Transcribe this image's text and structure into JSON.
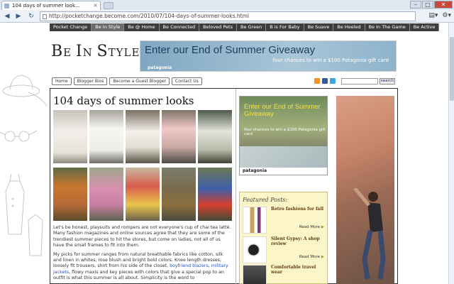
{
  "browser": {
    "tab_title": "104 days of summer look...",
    "tab_close": "×",
    "url": "http://pocketchange.become.com/2010/07/104-days-of-summer-looks.html",
    "back": "◀",
    "forward": "▶",
    "reload": "↻",
    "page_menu": "▤▾",
    "tools_menu": "⚙▾",
    "window_buttons": [
      "–",
      "□",
      "✕"
    ]
  },
  "site_nav": [
    "Pocket Change",
    "Be In Style",
    "Be @ Home",
    "Be Connected",
    "Beloved Pets",
    "Be Green",
    "B is For Baby",
    "Be Suave",
    "Be Heeled",
    "Be In The Game",
    "Be Active"
  ],
  "site_nav_active": "Be In Style",
  "logo": {
    "part1": "B",
    "part2": "E ",
    "part3": "I",
    "part4": "N ",
    "part5": "S",
    "part6": "TYLE"
  },
  "banner_top": {
    "headline": "Enter our End of Summer Giveaway",
    "sub": "four chances to win a $100 Patagonia gift card",
    "brand": "patagonia"
  },
  "sub_nav": [
    "Home",
    "Blogger Bios",
    "Become a Guest Blogger",
    "Contact Us"
  ],
  "search": {
    "button": "search"
  },
  "post": {
    "title": "104 days of summer looks",
    "p1": "Let's be honest, playsuits and rompers are not everyone's cup of chai tea latté. Many fashion magazines and online sources agree that they are some of the trendiest summer pieces to hit the stores, but come on ladies, not all of us have the small frames to fit into them.",
    "p2_a": "My picks for summer ranges from natural breathable fabrics like cotton, silk and linen in whites, rose blush and bright bold colors. Knee length dresses, loosely fit trousers, shirt from his side of the closet, ",
    "p2_link1": "boyfriend blazers",
    "p2_b": ", ",
    "p2_link2": "military jackets",
    "p2_c": ", flowy maxis and key pieces with colors that give a special pop to an outfit is what this summer is all about. Simplicity is the word to"
  },
  "ad_mid": {
    "headline": "Enter our End of Summer Giveaway",
    "sub": "four chances to win a $100 Patagonia gift card",
    "brand": "patagonia"
  },
  "featured": {
    "heading": "Featured Posts:",
    "items": [
      {
        "title": "Retro fashions for fall",
        "more": "Read More"
      },
      {
        "title": "Silent Gypsy: A shop review",
        "more": "Read More"
      },
      {
        "title": "Comfortable travel wear",
        "more": "Read More"
      }
    ]
  },
  "colors": {
    "nav_bg": "#3d3d3d",
    "link": "#2a54b5",
    "featured_bg": "#fbf5c8"
  }
}
